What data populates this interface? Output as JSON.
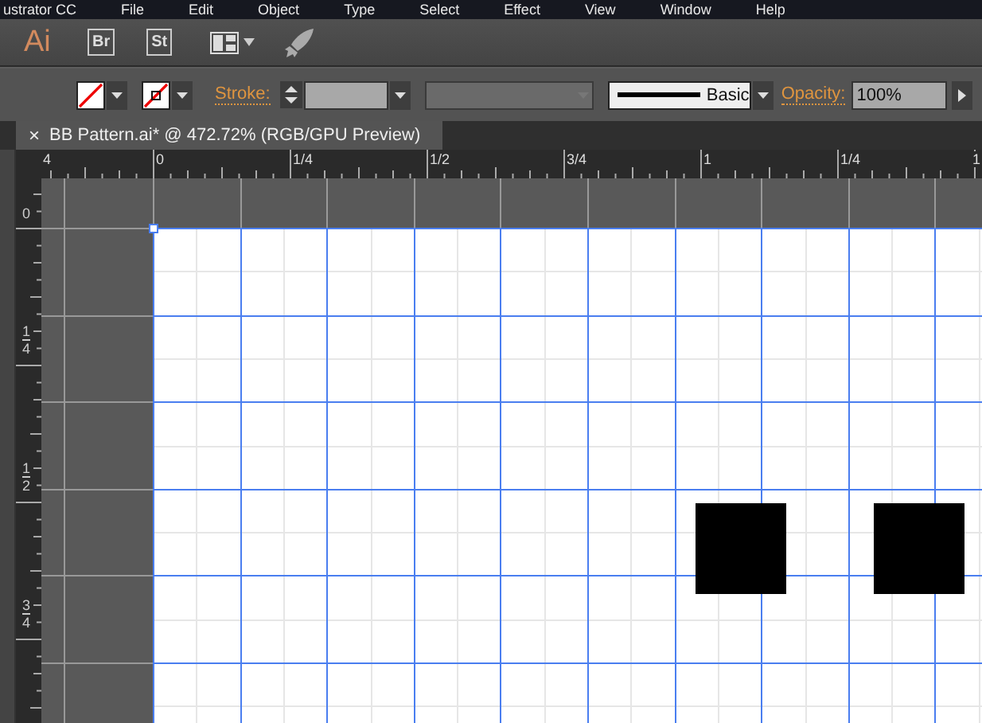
{
  "menu_bar": {
    "app": "ustrator CC",
    "items": [
      "File",
      "Edit",
      "Object",
      "Type",
      "Select",
      "Effect",
      "View",
      "Window",
      "Help"
    ]
  },
  "app_bar": {
    "logo": "Ai",
    "buttons": [
      "Br",
      "St"
    ]
  },
  "control_bar": {
    "stroke_label": "Stroke:",
    "brush": "Basic",
    "opacity_label": "Opacity:",
    "opacity_value": "100%"
  },
  "document_tab": {
    "close": "×",
    "title": "BB Pattern.ai* @ 472.72% (RGB/GPU Preview)",
    "selected": true
  },
  "rulers": {
    "horizontal": [
      "4",
      "0",
      "1/4",
      "1/2",
      "3/4",
      "1",
      "1/4",
      "1"
    ],
    "vertical": [
      {
        "kind": "whole",
        "text": "0"
      },
      {
        "kind": "fraction",
        "numerator": "1",
        "denominator": "4"
      },
      {
        "kind": "fraction",
        "numerator": "1",
        "denominator": "2"
      },
      {
        "kind": "fraction",
        "numerator": "3",
        "denominator": "4"
      }
    ]
  }
}
